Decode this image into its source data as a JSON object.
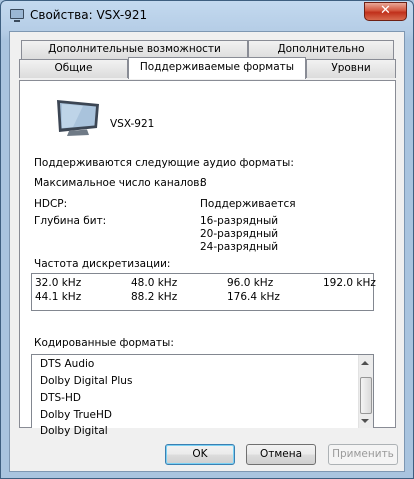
{
  "window": {
    "title": "Свойства: VSX-921",
    "close_label": "✕"
  },
  "tabs": {
    "row1": [
      "Дополнительные возможности",
      "Дополнительно"
    ],
    "row2": [
      "Общие",
      "Поддерживаемые форматы",
      "Уровни"
    ],
    "active": "Поддерживаемые форматы"
  },
  "device": {
    "name": "VSX-921"
  },
  "audio": {
    "heading": "Поддерживаются следующие аудио форматы:",
    "max_channels_label": "Максимальное число каналов:",
    "max_channels_value": "8",
    "hdcp_label": "HDCP:",
    "hdcp_value": "Поддерживается",
    "bit_depth_label": "Глубина бит:",
    "bit_depths": [
      "16-разрядный",
      "20-разрядный",
      "24-разрядный"
    ],
    "sample_rate_label": "Частота дискретизации:",
    "sample_rates": [
      "32.0 kHz",
      "48.0 kHz",
      "96.0 kHz",
      "192.0 kHz",
      "44.1 kHz",
      "88.2 kHz",
      "176.4 kHz"
    ],
    "encoded_label": "Кодированные форматы:",
    "encoded_formats": [
      "DTS Audio",
      "Dolby Digital Plus",
      "DTS-HD",
      "Dolby TrueHD",
      "Dolby Digital"
    ]
  },
  "buttons": {
    "ok": "OK",
    "cancel": "Отмена",
    "apply": "Применить"
  }
}
